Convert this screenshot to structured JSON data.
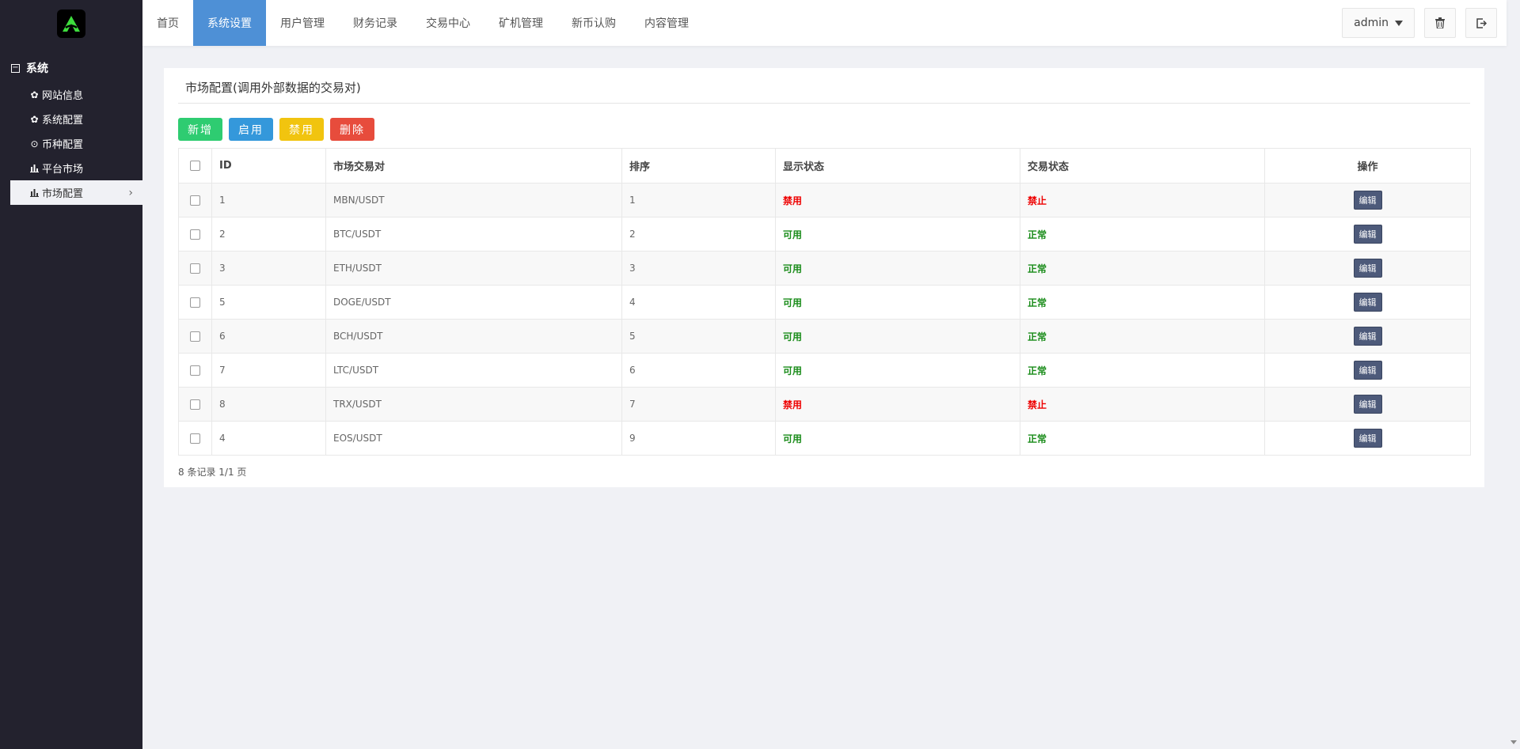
{
  "nav_tabs": [
    {
      "label": "首页"
    },
    {
      "label": "系统设置"
    },
    {
      "label": "用户管理"
    },
    {
      "label": "财务记录"
    },
    {
      "label": "交易中心"
    },
    {
      "label": "矿机管理"
    },
    {
      "label": "新币认购"
    },
    {
      "label": "内容管理"
    }
  ],
  "user": {
    "name": "admin"
  },
  "sidebar": {
    "group_label": "系统",
    "items": [
      {
        "label": "网站信息",
        "icon": "gear-icon"
      },
      {
        "label": "系统配置",
        "icon": "gear-icon"
      },
      {
        "label": "币种配置",
        "icon": "target-icon"
      },
      {
        "label": "平台市场",
        "icon": "bar-chart-icon"
      },
      {
        "label": "市场配置",
        "icon": "bar-chart-icon"
      }
    ]
  },
  "panel": {
    "title": "市场配置(调用外部数据的交易对)"
  },
  "actions": {
    "add": "新增",
    "enable": "启用",
    "disable": "禁用",
    "delete": "删除"
  },
  "table": {
    "headers": {
      "id": "ID",
      "pair": "市场交易对",
      "sort": "排序",
      "display": "显示状态",
      "trade": "交易状态",
      "ops": "操作"
    },
    "edit_label": "编辑",
    "rows": [
      {
        "id": "1",
        "pair": "MBN/USDT",
        "sort": "1",
        "display": "禁用",
        "trade": "禁止"
      },
      {
        "id": "2",
        "pair": "BTC/USDT",
        "sort": "2",
        "display": "可用",
        "trade": "正常"
      },
      {
        "id": "3",
        "pair": "ETH/USDT",
        "sort": "3",
        "display": "可用",
        "trade": "正常"
      },
      {
        "id": "5",
        "pair": "DOGE/USDT",
        "sort": "4",
        "display": "可用",
        "trade": "正常"
      },
      {
        "id": "6",
        "pair": "BCH/USDT",
        "sort": "5",
        "display": "可用",
        "trade": "正常"
      },
      {
        "id": "7",
        "pair": "LTC/USDT",
        "sort": "6",
        "display": "可用",
        "trade": "正常"
      },
      {
        "id": "8",
        "pair": "TRX/USDT",
        "sort": "7",
        "display": "禁用",
        "trade": "禁止"
      },
      {
        "id": "4",
        "pair": "EOS/USDT",
        "sort": "9",
        "display": "可用",
        "trade": "正常"
      }
    ]
  },
  "pagination": {
    "text": "8 条记录 1/1 页"
  },
  "colors": {
    "active_tab": "#4e90d6",
    "sidebar_bg": "#23222e",
    "status_ok": "#1a8c1a",
    "status_bad": "#e00000",
    "logo_green": "#3ddc3d"
  }
}
